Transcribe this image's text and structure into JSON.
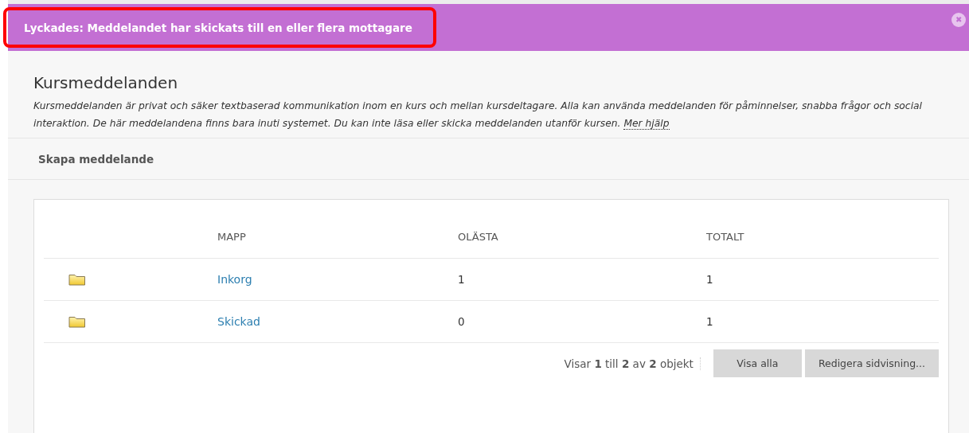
{
  "banner": {
    "message": "Lyckades: Meddelandet har skickats till en eller flera mottagare",
    "highlighted": true,
    "close_label": "✖"
  },
  "page": {
    "title": "Kursmeddelanden",
    "description": "Kursmeddelanden är privat och säker textbaserad kommunikation inom en kurs och mellan kursdeltagare. Alla kan använda meddelanden för påminnelser, snabba frågor och social interaktion. De här meddelandena finns bara inuti systemet. Du kan inte läsa eller skicka meddelanden utanför kursen.",
    "help_link": "Mer hjälp"
  },
  "action_bar": {
    "create_label": "Skapa meddelande"
  },
  "table": {
    "columns": [
      "MAPP",
      "OLÄSTA",
      "TOTALT"
    ],
    "rows": [
      {
        "folder": "Inkorg",
        "unread": "1",
        "total": "1"
      },
      {
        "folder": "Skickad",
        "unread": "0",
        "total": "1"
      }
    ],
    "pagination": {
      "summary": "Visar **1** till **2** av **2** objekt",
      "buttons": [
        "Visa alla",
        "Redigera sidvisning..."
      ]
    }
  }
}
